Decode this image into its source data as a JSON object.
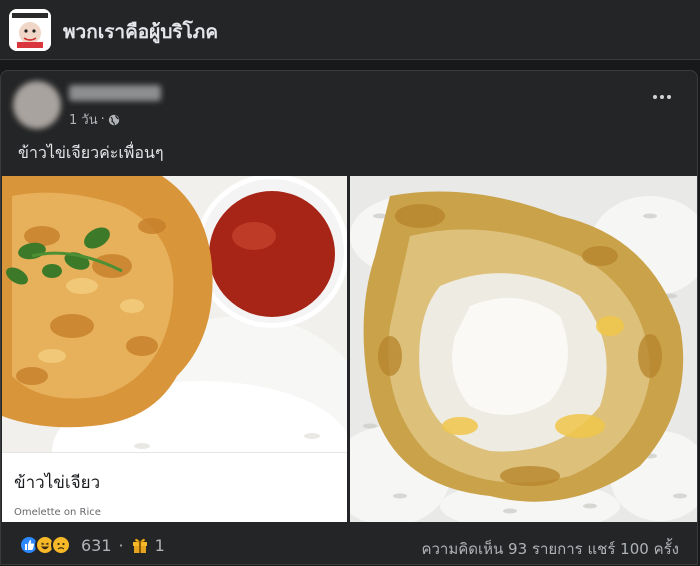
{
  "header": {
    "group_name": "พวกเราคือผู้บริโภค",
    "group_avatar_icon": "group-logo"
  },
  "post": {
    "time": "1 วัน",
    "time_separator": "·",
    "privacy_icon": "globe-icon",
    "text": "ข้าวไข่เจียวค่ะเพื่อนๆ",
    "menu_icon": "more-options-icon",
    "photos": [
      {
        "caption_title": "ข้าวไข่เจียว",
        "caption_subtitle": "Omelette on Rice"
      },
      {}
    ]
  },
  "footer": {
    "reaction_icons": [
      "like-icon",
      "haha-icon",
      "sad-icon"
    ],
    "reaction_count": "631",
    "separator": "·",
    "gift_icon": "gift-icon",
    "gift_count": "1",
    "stats_text": "ความคิดเห็น 93 รายการ แชร์ 100 ครั้ง"
  },
  "colors": {
    "background": "#18191a",
    "card": "#242526",
    "text": "#e4e6eb",
    "secondary_text": "#b0b3b8",
    "like_blue": "#2d88ff",
    "reaction_yellow": "#f7b928"
  }
}
